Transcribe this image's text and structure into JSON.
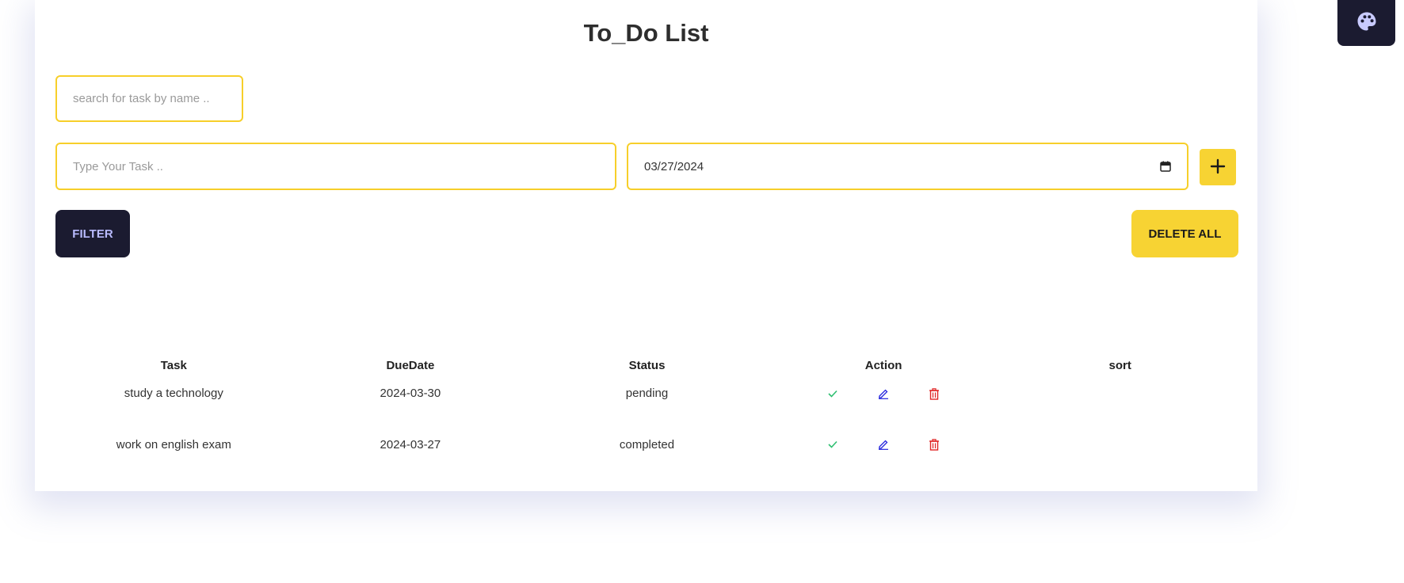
{
  "header": {
    "title": "To_Do List"
  },
  "search": {
    "placeholder": "search for task by name .."
  },
  "new_task": {
    "placeholder": "Type Your Task ..",
    "date_value": "03/27/2024",
    "add_icon": "plus-icon"
  },
  "buttons": {
    "filter_label": "FILTER",
    "delete_all_label": "DELETE ALL"
  },
  "table": {
    "headers": [
      "Task",
      "DueDate",
      "Status",
      "Action",
      "sort"
    ],
    "rows": [
      {
        "task": "study a technology",
        "due_date": "2024-03-30",
        "status": "pending"
      },
      {
        "task": "work on english exam",
        "due_date": "2024-03-27",
        "status": "completed"
      }
    ],
    "action_icons": [
      "check-icon",
      "edit-icon",
      "trash-icon"
    ]
  },
  "theme_button": {
    "icon": "palette-icon"
  },
  "colors": {
    "accent_yellow": "#f7d333",
    "dark_navy": "#1b1b30",
    "filter_text": "#b9bbff",
    "complete_green": "#2fbf71",
    "edit_blue": "#2222dd",
    "delete_red": "#e02424"
  }
}
